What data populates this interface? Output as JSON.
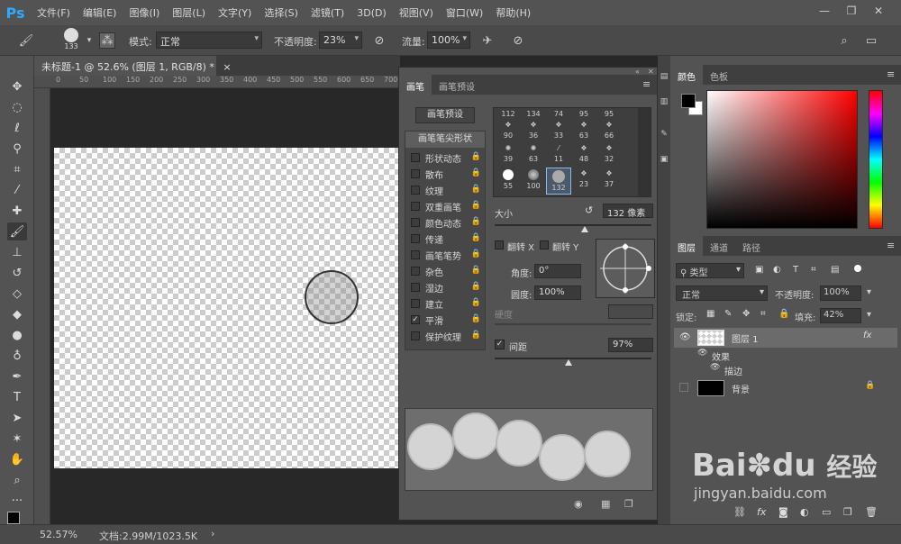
{
  "menubar": {
    "logo": "Ps",
    "items": [
      "文件(F)",
      "编辑(E)",
      "图像(I)",
      "图层(L)",
      "文字(Y)",
      "选择(S)",
      "滤镜(T)",
      "3D(D)",
      "视图(V)",
      "窗口(W)",
      "帮助(H)"
    ],
    "window_controls": [
      "—",
      "❐",
      "✕"
    ]
  },
  "options": {
    "brush_size": "133",
    "mode_label": "模式:",
    "mode_value": "正常",
    "opacity_label": "不透明度:",
    "opacity_value": "23%",
    "flow_label": "流量:",
    "flow_value": "100%"
  },
  "document": {
    "tab_title": "未标题-1 @ 52.6% (图层 1, RGB/8) *",
    "close": "×",
    "ruler_ticks": [
      "0",
      "50",
      "100",
      "150",
      "200",
      "250",
      "300",
      "350",
      "400",
      "450",
      "500",
      "550",
      "600",
      "650",
      "700"
    ]
  },
  "status": {
    "zoom": "52.57%",
    "doc_info": "文档:2.99M/1023.5K",
    "arrow": "›"
  },
  "brush_panel": {
    "tabs": [
      "画笔",
      "画笔预设"
    ],
    "preset_button": "画笔预设",
    "list_header": "画笔笔尖形状",
    "options": [
      {
        "label": "形状动态",
        "checked": false
      },
      {
        "label": "散布",
        "checked": false
      },
      {
        "label": "纹理",
        "checked": false
      },
      {
        "label": "双重画笔",
        "checked": false
      },
      {
        "label": "颜色动态",
        "checked": false
      },
      {
        "label": "传递",
        "checked": false
      },
      {
        "label": "画笔笔势",
        "checked": false
      },
      {
        "label": "杂色",
        "checked": false
      },
      {
        "label": "湿边",
        "checked": false
      },
      {
        "label": "建立",
        "checked": false
      },
      {
        "label": "平滑",
        "checked": true
      },
      {
        "label": "保护纹理",
        "checked": false
      }
    ],
    "tips": [
      [
        "112",
        "134",
        "74",
        "95",
        "95"
      ],
      [
        "90",
        "36",
        "33",
        "63",
        "66"
      ],
      [
        "39",
        "63",
        "11",
        "48",
        "32"
      ],
      [
        "55",
        "100",
        "132",
        "23",
        "37"
      ]
    ],
    "size_label": "大小",
    "size_value": "132 像素",
    "flip_x_label": "翻转 X",
    "flip_y_label": "翻转 Y",
    "angle_label": "角度:",
    "angle_value": "0°",
    "roundness_label": "圆度:",
    "roundness_value": "100%",
    "hardness_label": "硬度",
    "spacing_label": "间距",
    "spacing_value": "97%",
    "spacing_checked": true
  },
  "color_panel": {
    "tabs": [
      "颜色",
      "色板"
    ]
  },
  "layers_panel": {
    "tabs": [
      "图层",
      "通道",
      "路径"
    ],
    "filter_value": "类型",
    "blend_mode": "正常",
    "opacity_label": "不透明度:",
    "opacity_value": "100%",
    "lock_label": "锁定:",
    "fill_label": "填充:",
    "fill_value": "42%",
    "layers": [
      {
        "name": "图层 1",
        "fx": "fx"
      },
      {
        "name": "效果"
      },
      {
        "name": "描边"
      },
      {
        "name": "背景"
      }
    ]
  },
  "watermark": {
    "brand": "Bai",
    "brand2": "du",
    "cn": "经验",
    "url": "jingyan.baidu.com"
  }
}
